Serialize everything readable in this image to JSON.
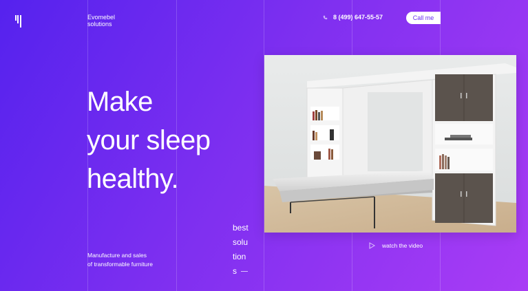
{
  "brand": {
    "line1": "Evomebel",
    "line2": "solutions"
  },
  "header": {
    "phone": "8 (499) 647-55-57",
    "call_label": "Call me"
  },
  "hero": {
    "headline_lines": [
      "Make",
      "your sleep",
      "healthy."
    ],
    "tagline_line1": "Manufacture and sales",
    "tagline_line2": "of transformable furniture"
  },
  "side_text": {
    "line1": "best",
    "line2": "solu",
    "line3": "tion",
    "line4": "s"
  },
  "video": {
    "label": "watch the video"
  },
  "icons": {
    "logo": "logo-bars-icon",
    "phone": "phone-icon",
    "play": "play-icon"
  },
  "colors": {
    "gradient_start": "#5522ee",
    "gradient_end": "#a93cf5",
    "button_text": "#6a2ff0"
  }
}
